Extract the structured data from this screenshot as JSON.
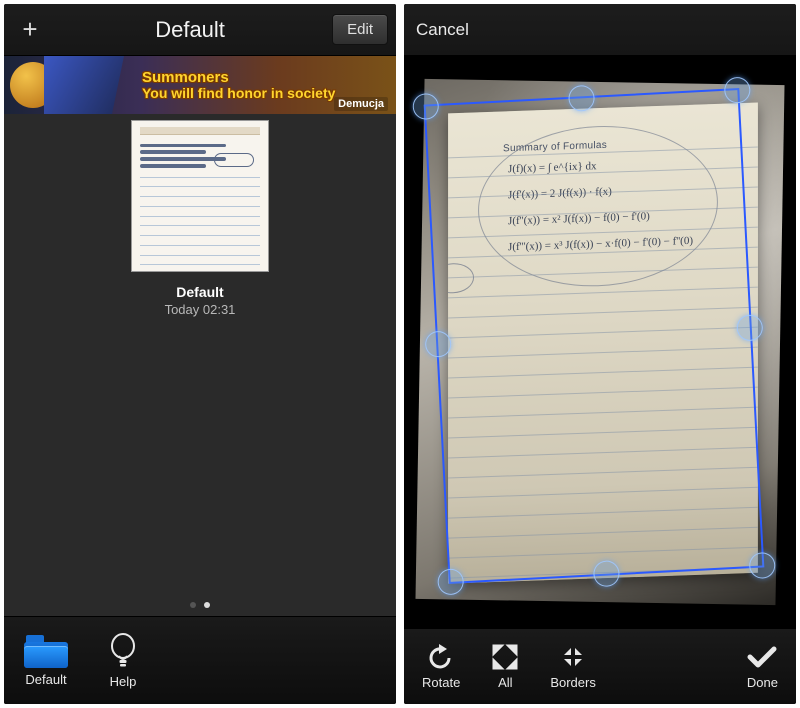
{
  "left": {
    "title": "Default",
    "edit_label": "Edit",
    "banner": {
      "line1": "Summoners",
      "line2": "You will find honor in society",
      "brand": "Demucja"
    },
    "doc": {
      "name": "Default",
      "time": "Today 02:31"
    },
    "tabs": {
      "docs": "Default",
      "help": "Help"
    }
  },
  "right": {
    "cancel_label": "Cancel",
    "tools": {
      "rotate": "Rotate",
      "all": "All",
      "borders": "Borders",
      "done": "Done"
    },
    "paper": {
      "heading": "Summary of Formulas",
      "eqs": [
        "J(f)(x) = ∫ e^{ix} dx",
        "J(f'(x)) = 2 J(f(x)) · f(x)",
        "J(f''(x)) = x² J(f(x)) − f(0) − f'(0)",
        "J(f'''(x)) = x³ J(f(x)) − x·f(0) − f'(0) − f''(0)"
      ]
    }
  }
}
